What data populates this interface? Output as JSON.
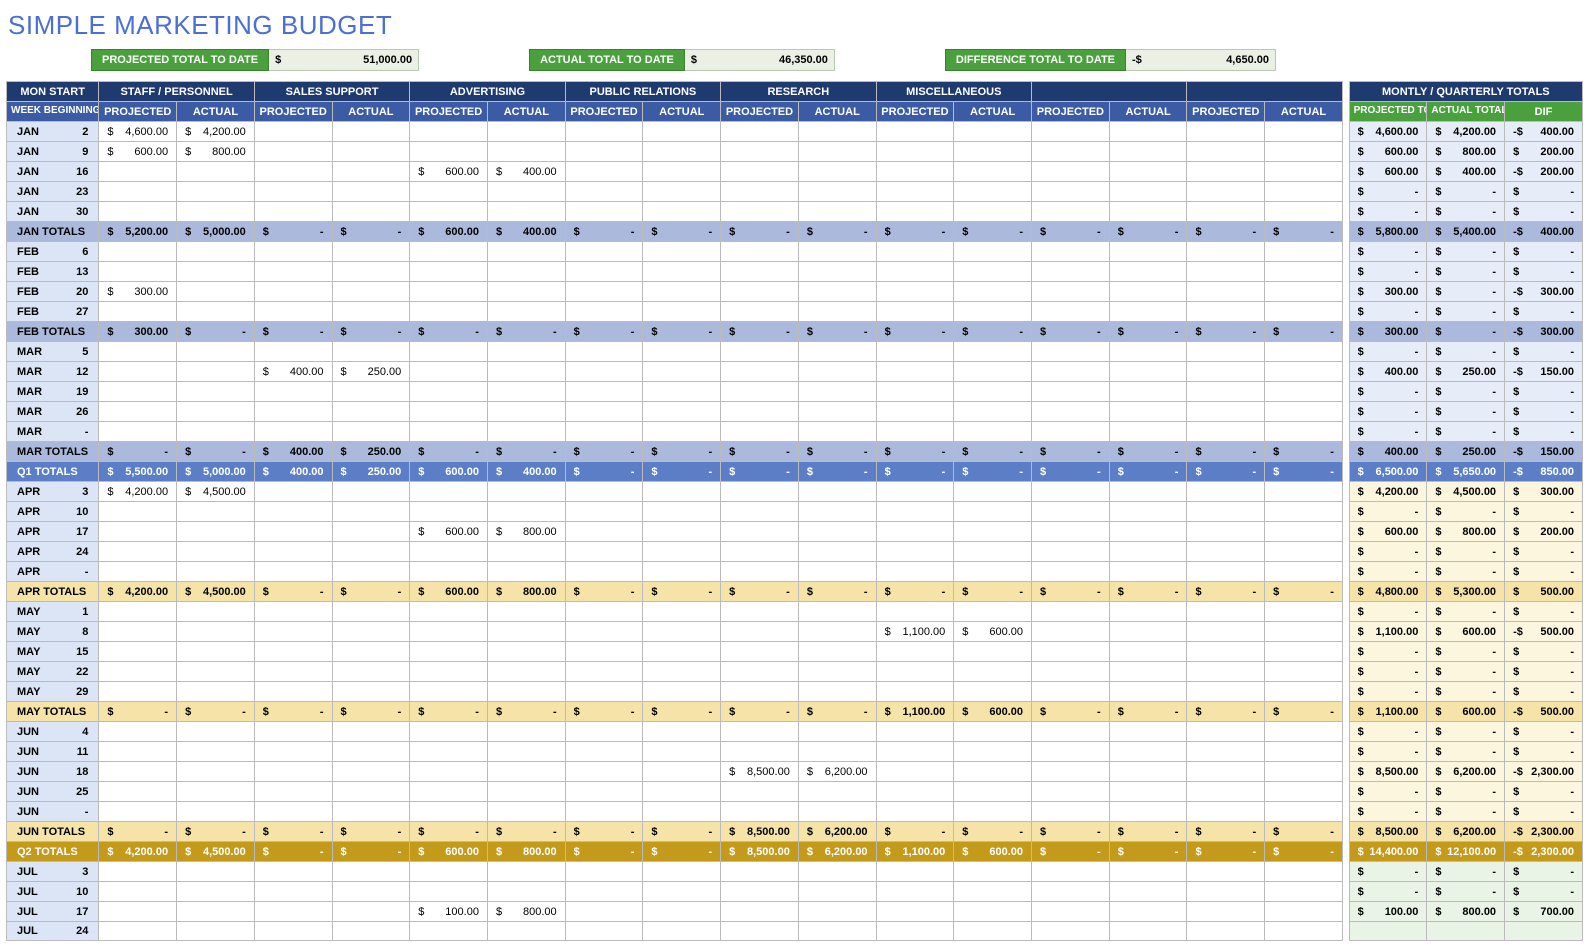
{
  "title": "SIMPLE MARKETING BUDGET",
  "summary": {
    "projected_label": "PROJECTED TOTAL TO DATE",
    "projected_sym": "$",
    "projected_val": "51,000.00",
    "actual_label": "ACTUAL TOTAL TO DATE",
    "actual_sym": "$",
    "actual_val": "46,350.00",
    "diff_label": "DIFFERENCE TOTAL TO DATE",
    "diff_sym": "-$",
    "diff_val": "4,650.00"
  },
  "colors": {
    "q1_blue1": "#aab9dc",
    "q1_blue2": "#5b7ec7",
    "q2_yel1": "#f5e3a8",
    "q2_yel2": "#c49a1a",
    "q3_grn1": "#d7e8d2",
    "totals_pale_blue": "#e6edf9",
    "totals_pale_yel": "#fdf6df",
    "totals_pale_grn": "#eaf4e6"
  },
  "headers": {
    "monstart": "MON START",
    "week": "WEEK BEGINNING",
    "groups": [
      "STAFF / PERSONNEL",
      "SALES SUPPORT",
      "ADVERTISING",
      "PUBLIC RELATIONS",
      "RESEARCH",
      "MISCELLANEOUS",
      "",
      ""
    ],
    "sub_proj": "PROJECTED",
    "sub_act": "ACTUAL",
    "totals_group": "MONTLY / QUARTERLY TOTALS",
    "totals_cols": [
      "PROJECTED TOTALS",
      "ACTUAL TOTALS",
      "DIF"
    ]
  },
  "rows": [
    {
      "type": "data",
      "label": "JAN",
      "day": "2",
      "proj": [
        "4,600.00",
        "",
        "",
        "",
        "",
        "",
        "",
        ""
      ],
      "act": [
        "4,200.00",
        "",
        "",
        "",
        "",
        "",
        "",
        ""
      ],
      "tproj": "4,600.00",
      "tact": "4,200.00",
      "tdif": "400.00",
      "dneg": true,
      "tbg": "totals_pale_blue"
    },
    {
      "type": "data",
      "label": "JAN",
      "day": "9",
      "proj": [
        "600.00",
        "",
        "",
        "",
        "",
        "",
        "",
        ""
      ],
      "act": [
        "800.00",
        "",
        "",
        "",
        "",
        "",
        "",
        ""
      ],
      "tproj": "600.00",
      "tact": "800.00",
      "tdif": "200.00",
      "dneg": false,
      "tbg": "totals_pale_blue"
    },
    {
      "type": "data",
      "label": "JAN",
      "day": "16",
      "proj": [
        "",
        "",
        "600.00",
        "",
        "",
        "",
        "",
        ""
      ],
      "act": [
        "",
        "",
        "400.00",
        "",
        "",
        "",
        "",
        ""
      ],
      "tproj": "600.00",
      "tact": "400.00",
      "tdif": "200.00",
      "dneg": true,
      "tbg": "totals_pale_blue"
    },
    {
      "type": "data",
      "label": "JAN",
      "day": "23",
      "proj": [
        "",
        "",
        "",
        "",
        "",
        "",
        "",
        ""
      ],
      "act": [
        "",
        "",
        "",
        "",
        "",
        "",
        "",
        ""
      ],
      "tproj": "-",
      "tact": "-",
      "tdif": "-",
      "dneg": false,
      "tbg": "totals_pale_blue"
    },
    {
      "type": "data",
      "label": "JAN",
      "day": "30",
      "proj": [
        "",
        "",
        "",
        "",
        "",
        "",
        "",
        ""
      ],
      "act": [
        "",
        "",
        "",
        "",
        "",
        "",
        "",
        ""
      ],
      "tproj": "-",
      "tact": "-",
      "tdif": "-",
      "dneg": false,
      "tbg": "totals_pale_blue"
    },
    {
      "type": "subtotal",
      "label": "JAN TOTALS",
      "bg": "q1_blue1",
      "proj": [
        "5,200.00",
        "-",
        "600.00",
        "-",
        "-",
        "-",
        "-",
        "-"
      ],
      "act": [
        "5,000.00",
        "-",
        "400.00",
        "-",
        "-",
        "-",
        "-",
        "-"
      ],
      "tproj": "5,800.00",
      "tact": "5,400.00",
      "tdif": "400.00",
      "dneg": true,
      "tbg": "q1_blue1"
    },
    {
      "type": "data",
      "label": "FEB",
      "day": "6",
      "proj": [
        "",
        "",
        "",
        "",
        "",
        "",
        "",
        ""
      ],
      "act": [
        "",
        "",
        "",
        "",
        "",
        "",
        "",
        ""
      ],
      "tproj": "-",
      "tact": "-",
      "tdif": "-",
      "dneg": false,
      "tbg": "totals_pale_blue"
    },
    {
      "type": "data",
      "label": "FEB",
      "day": "13",
      "proj": [
        "",
        "",
        "",
        "",
        "",
        "",
        "",
        ""
      ],
      "act": [
        "",
        "",
        "",
        "",
        "",
        "",
        "",
        ""
      ],
      "tproj": "-",
      "tact": "-",
      "tdif": "-",
      "dneg": false,
      "tbg": "totals_pale_blue"
    },
    {
      "type": "data",
      "label": "FEB",
      "day": "20",
      "proj": [
        "300.00",
        "",
        "",
        "",
        "",
        "",
        "",
        ""
      ],
      "act": [
        "",
        "",
        "",
        "",
        "",
        "",
        "",
        ""
      ],
      "tproj": "300.00",
      "tact": "-",
      "tdif": "300.00",
      "dneg": true,
      "tbg": "totals_pale_blue"
    },
    {
      "type": "data",
      "label": "FEB",
      "day": "27",
      "proj": [
        "",
        "",
        "",
        "",
        "",
        "",
        "",
        ""
      ],
      "act": [
        "",
        "",
        "",
        "",
        "",
        "",
        "",
        ""
      ],
      "tproj": "-",
      "tact": "-",
      "tdif": "-",
      "dneg": false,
      "tbg": "totals_pale_blue"
    },
    {
      "type": "subtotal",
      "label": "FEB TOTALS",
      "bg": "q1_blue1",
      "proj": [
        "300.00",
        "-",
        "-",
        "-",
        "-",
        "-",
        "-",
        "-"
      ],
      "act": [
        "-",
        "-",
        "-",
        "-",
        "-",
        "-",
        "-",
        "-"
      ],
      "tproj": "300.00",
      "tact": "-",
      "tdif": "300.00",
      "dneg": true,
      "tbg": "q1_blue1"
    },
    {
      "type": "data",
      "label": "MAR",
      "day": "5",
      "proj": [
        "",
        "",
        "",
        "",
        "",
        "",
        "",
        ""
      ],
      "act": [
        "",
        "",
        "",
        "",
        "",
        "",
        "",
        ""
      ],
      "tproj": "-",
      "tact": "-",
      "tdif": "-",
      "dneg": false,
      "tbg": "totals_pale_blue"
    },
    {
      "type": "data",
      "label": "MAR",
      "day": "12",
      "proj": [
        "",
        "400.00",
        "",
        "",
        "",
        "",
        "",
        ""
      ],
      "act": [
        "",
        "250.00",
        "",
        "",
        "",
        "",
        "",
        ""
      ],
      "tproj": "400.00",
      "tact": "250.00",
      "tdif": "150.00",
      "dneg": true,
      "tbg": "totals_pale_blue"
    },
    {
      "type": "data",
      "label": "MAR",
      "day": "19",
      "proj": [
        "",
        "",
        "",
        "",
        "",
        "",
        "",
        ""
      ],
      "act": [
        "",
        "",
        "",
        "",
        "",
        "",
        "",
        ""
      ],
      "tproj": "-",
      "tact": "-",
      "tdif": "-",
      "dneg": false,
      "tbg": "totals_pale_blue"
    },
    {
      "type": "data",
      "label": "MAR",
      "day": "26",
      "proj": [
        "",
        "",
        "",
        "",
        "",
        "",
        "",
        ""
      ],
      "act": [
        "",
        "",
        "",
        "",
        "",
        "",
        "",
        ""
      ],
      "tproj": "-",
      "tact": "-",
      "tdif": "-",
      "dneg": false,
      "tbg": "totals_pale_blue"
    },
    {
      "type": "data",
      "label": "MAR",
      "day": "-",
      "proj": [
        "",
        "",
        "",
        "",
        "",
        "",
        "",
        ""
      ],
      "act": [
        "",
        "",
        "",
        "",
        "",
        "",
        "",
        ""
      ],
      "tproj": "-",
      "tact": "-",
      "tdif": "-",
      "dneg": false,
      "tbg": "totals_pale_blue"
    },
    {
      "type": "subtotal",
      "label": "MAR TOTALS",
      "bg": "q1_blue1",
      "proj": [
        "-",
        "400.00",
        "-",
        "-",
        "-",
        "-",
        "-",
        "-"
      ],
      "act": [
        "-",
        "250.00",
        "-",
        "-",
        "-",
        "-",
        "-",
        "-"
      ],
      "tproj": "400.00",
      "tact": "250.00",
      "tdif": "150.00",
      "dneg": true,
      "tbg": "q1_blue1"
    },
    {
      "type": "qtotal",
      "label": "Q1 TOTALS",
      "bg": "q1_blue2",
      "proj": [
        "5,500.00",
        "400.00",
        "600.00",
        "-",
        "-",
        "-",
        "-",
        "-"
      ],
      "act": [
        "5,000.00",
        "250.00",
        "400.00",
        "-",
        "-",
        "-",
        "-",
        "-"
      ],
      "tproj": "6,500.00",
      "tact": "5,650.00",
      "tdif": "850.00",
      "dneg": true,
      "tbg": "q1_blue2"
    },
    {
      "type": "data",
      "label": "APR",
      "day": "3",
      "proj": [
        "4,200.00",
        "",
        "",
        "",
        "",
        "",
        "",
        ""
      ],
      "act": [
        "4,500.00",
        "",
        "",
        "",
        "",
        "",
        "",
        ""
      ],
      "tproj": "4,200.00",
      "tact": "4,500.00",
      "tdif": "300.00",
      "dneg": false,
      "tbg": "totals_pale_yel"
    },
    {
      "type": "data",
      "label": "APR",
      "day": "10",
      "proj": [
        "",
        "",
        "",
        "",
        "",
        "",
        "",
        ""
      ],
      "act": [
        "",
        "",
        "",
        "",
        "",
        "",
        "",
        ""
      ],
      "tproj": "-",
      "tact": "-",
      "tdif": "-",
      "dneg": false,
      "tbg": "totals_pale_yel"
    },
    {
      "type": "data",
      "label": "APR",
      "day": "17",
      "proj": [
        "",
        "",
        "600.00",
        "",
        "",
        "",
        "",
        ""
      ],
      "act": [
        "",
        "",
        "800.00",
        "",
        "",
        "",
        "",
        ""
      ],
      "tproj": "600.00",
      "tact": "800.00",
      "tdif": "200.00",
      "dneg": false,
      "tbg": "totals_pale_yel"
    },
    {
      "type": "data",
      "label": "APR",
      "day": "24",
      "proj": [
        "",
        "",
        "",
        "",
        "",
        "",
        "",
        ""
      ],
      "act": [
        "",
        "",
        "",
        "",
        "",
        "",
        "",
        ""
      ],
      "tproj": "-",
      "tact": "-",
      "tdif": "-",
      "dneg": false,
      "tbg": "totals_pale_yel"
    },
    {
      "type": "data",
      "label": "APR",
      "day": "-",
      "proj": [
        "",
        "",
        "",
        "",
        "",
        "",
        "",
        ""
      ],
      "act": [
        "",
        "",
        "",
        "",
        "",
        "",
        "",
        ""
      ],
      "tproj": "-",
      "tact": "-",
      "tdif": "-",
      "dneg": false,
      "tbg": "totals_pale_yel"
    },
    {
      "type": "subtotal",
      "label": "APR TOTALS",
      "bg": "q2_yel1",
      "proj": [
        "4,200.00",
        "-",
        "600.00",
        "-",
        "-",
        "-",
        "-",
        "-"
      ],
      "act": [
        "4,500.00",
        "-",
        "800.00",
        "-",
        "-",
        "-",
        "-",
        "-"
      ],
      "tproj": "4,800.00",
      "tact": "5,300.00",
      "tdif": "500.00",
      "dneg": false,
      "tbg": "q2_yel1"
    },
    {
      "type": "data",
      "label": "MAY",
      "day": "1",
      "proj": [
        "",
        "",
        "",
        "",
        "",
        "",
        "",
        ""
      ],
      "act": [
        "",
        "",
        "",
        "",
        "",
        "",
        "",
        ""
      ],
      "tproj": "-",
      "tact": "-",
      "tdif": "-",
      "dneg": false,
      "tbg": "totals_pale_yel"
    },
    {
      "type": "data",
      "label": "MAY",
      "day": "8",
      "proj": [
        "",
        "",
        "",
        "",
        "",
        "1,100.00",
        "",
        ""
      ],
      "act": [
        "",
        "",
        "",
        "",
        "",
        "600.00",
        "",
        ""
      ],
      "tproj": "1,100.00",
      "tact": "600.00",
      "tdif": "500.00",
      "dneg": true,
      "tbg": "totals_pale_yel"
    },
    {
      "type": "data",
      "label": "MAY",
      "day": "15",
      "proj": [
        "",
        "",
        "",
        "",
        "",
        "",
        "",
        ""
      ],
      "act": [
        "",
        "",
        "",
        "",
        "",
        "",
        "",
        ""
      ],
      "tproj": "-",
      "tact": "-",
      "tdif": "-",
      "dneg": false,
      "tbg": "totals_pale_yel"
    },
    {
      "type": "data",
      "label": "MAY",
      "day": "22",
      "proj": [
        "",
        "",
        "",
        "",
        "",
        "",
        "",
        ""
      ],
      "act": [
        "",
        "",
        "",
        "",
        "",
        "",
        "",
        ""
      ],
      "tproj": "-",
      "tact": "-",
      "tdif": "-",
      "dneg": false,
      "tbg": "totals_pale_yel"
    },
    {
      "type": "data",
      "label": "MAY",
      "day": "29",
      "proj": [
        "",
        "",
        "",
        "",
        "",
        "",
        "",
        ""
      ],
      "act": [
        "",
        "",
        "",
        "",
        "",
        "",
        "",
        ""
      ],
      "tproj": "-",
      "tact": "-",
      "tdif": "-",
      "dneg": false,
      "tbg": "totals_pale_yel"
    },
    {
      "type": "subtotal",
      "label": "MAY TOTALS",
      "bg": "q2_yel1",
      "proj": [
        "-",
        "-",
        "-",
        "-",
        "-",
        "1,100.00",
        "-",
        "-"
      ],
      "act": [
        "-",
        "-",
        "-",
        "-",
        "-",
        "600.00",
        "-",
        "-"
      ],
      "tproj": "1,100.00",
      "tact": "600.00",
      "tdif": "500.00",
      "dneg": true,
      "tbg": "q2_yel1"
    },
    {
      "type": "data",
      "label": "JUN",
      "day": "4",
      "proj": [
        "",
        "",
        "",
        "",
        "",
        "",
        "",
        ""
      ],
      "act": [
        "",
        "",
        "",
        "",
        "",
        "",
        "",
        ""
      ],
      "tproj": "-",
      "tact": "-",
      "tdif": "-",
      "dneg": false,
      "tbg": "totals_pale_yel"
    },
    {
      "type": "data",
      "label": "JUN",
      "day": "11",
      "proj": [
        "",
        "",
        "",
        "",
        "",
        "",
        "",
        ""
      ],
      "act": [
        "",
        "",
        "",
        "",
        "",
        "",
        "",
        ""
      ],
      "tproj": "-",
      "tact": "-",
      "tdif": "-",
      "dneg": false,
      "tbg": "totals_pale_yel"
    },
    {
      "type": "data",
      "label": "JUN",
      "day": "18",
      "proj": [
        "",
        "",
        "",
        "",
        "8,500.00",
        "",
        "",
        ""
      ],
      "act": [
        "",
        "",
        "",
        "",
        "6,200.00",
        "",
        "",
        ""
      ],
      "tproj": "8,500.00",
      "tact": "6,200.00",
      "tdif": "2,300.00",
      "dneg": true,
      "tbg": "totals_pale_yel"
    },
    {
      "type": "data",
      "label": "JUN",
      "day": "25",
      "proj": [
        "",
        "",
        "",
        "",
        "",
        "",
        "",
        ""
      ],
      "act": [
        "",
        "",
        "",
        "",
        "",
        "",
        "",
        ""
      ],
      "tproj": "-",
      "tact": "-",
      "tdif": "-",
      "dneg": false,
      "tbg": "totals_pale_yel"
    },
    {
      "type": "data",
      "label": "JUN",
      "day": "-",
      "proj": [
        "",
        "",
        "",
        "",
        "",
        "",
        "",
        ""
      ],
      "act": [
        "",
        "",
        "",
        "",
        "",
        "",
        "",
        ""
      ],
      "tproj": "-",
      "tact": "-",
      "tdif": "-",
      "dneg": false,
      "tbg": "totals_pale_yel"
    },
    {
      "type": "subtotal",
      "label": "JUN TOTALS",
      "bg": "q2_yel1",
      "proj": [
        "-",
        "-",
        "-",
        "-",
        "8,500.00",
        "-",
        "-",
        "-"
      ],
      "act": [
        "-",
        "-",
        "-",
        "-",
        "6,200.00",
        "-",
        "-",
        "-"
      ],
      "tproj": "8,500.00",
      "tact": "6,200.00",
      "tdif": "2,300.00",
      "dneg": true,
      "tbg": "q2_yel1"
    },
    {
      "type": "qtotal",
      "label": "Q2 TOTALS",
      "bg": "q2_yel2",
      "proj": [
        "4,200.00",
        "-",
        "600.00",
        "-",
        "8,500.00",
        "1,100.00",
        "-",
        "-"
      ],
      "act": [
        "4,500.00",
        "-",
        "800.00",
        "-",
        "6,200.00",
        "600.00",
        "-",
        "-"
      ],
      "tproj": "14,400.00",
      "tact": "12,100.00",
      "tdif": "2,300.00",
      "dneg": true,
      "tbg": "q2_yel2"
    },
    {
      "type": "data",
      "label": "JUL",
      "day": "3",
      "proj": [
        "",
        "",
        "",
        "",
        "",
        "",
        "",
        ""
      ],
      "act": [
        "",
        "",
        "",
        "",
        "",
        "",
        "",
        ""
      ],
      "tproj": "-",
      "tact": "-",
      "tdif": "-",
      "dneg": false,
      "tbg": "totals_pale_grn"
    },
    {
      "type": "data",
      "label": "JUL",
      "day": "10",
      "proj": [
        "",
        "",
        "",
        "",
        "",
        "",
        "",
        ""
      ],
      "act": [
        "",
        "",
        "",
        "",
        "",
        "",
        "",
        ""
      ],
      "tproj": "-",
      "tact": "-",
      "tdif": "-",
      "dneg": false,
      "tbg": "totals_pale_grn"
    },
    {
      "type": "data",
      "label": "JUL",
      "day": "17",
      "proj": [
        "",
        "",
        "100.00",
        "",
        "",
        "",
        "",
        ""
      ],
      "act": [
        "",
        "",
        "800.00",
        "",
        "",
        "",
        "",
        ""
      ],
      "tproj": "100.00",
      "tact": "800.00",
      "tdif": "700.00",
      "dneg": false,
      "tbg": "totals_pale_grn"
    },
    {
      "type": "data",
      "label": "JUL",
      "day": "24",
      "proj": [
        "",
        "",
        "",
        "",
        "",
        "",
        "",
        ""
      ],
      "act": [
        "",
        "",
        "",
        "",
        "",
        "",
        "",
        ""
      ],
      "tproj": "",
      "tact": "",
      "tdif": "",
      "dneg": false,
      "tbg": "totals_pale_grn",
      "partial": true
    }
  ]
}
